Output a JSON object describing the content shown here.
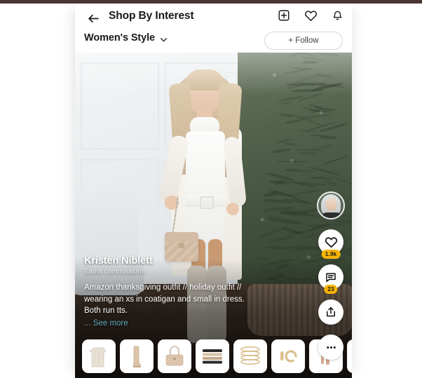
{
  "theme": {
    "top_border_color": "#4a3530",
    "badge_color": "#f5b400",
    "link_color": "#5aa9bd",
    "text_dark": "#17191a"
  },
  "header": {
    "back_icon": "back-arrow-icon",
    "title": "Shop By Interest",
    "icons": [
      {
        "name": "add-plus-square-icon",
        "label": "Add"
      },
      {
        "name": "heart-icon",
        "label": "Likes"
      },
      {
        "name": "bell-icon",
        "label": "Notifications"
      }
    ],
    "category": "Women's Style",
    "category_caret": "chevron-down-icon",
    "follow_label": "+ Follow"
  },
  "post": {
    "creator_name": "Kristen Niblett",
    "creator_subtitle": "Earns commissions",
    "caption": "Amazon thanksgiving outfit // holiday outfit // wearing an xs in coatigan and small in dress. Both run tts.",
    "see_more_dots": "... ",
    "see_more_label": "See more"
  },
  "rail": {
    "avatar_name": "creator-avatar",
    "actions": [
      {
        "name": "like-button",
        "icon": "heart-icon",
        "count": "1.9k"
      },
      {
        "name": "comment-button",
        "icon": "comment-bubble-icon",
        "count": "23"
      },
      {
        "name": "share-button",
        "icon": "share-upload-icon",
        "count": ""
      },
      {
        "name": "more-options-button",
        "icon": "ellipsis-icon",
        "count": ""
      }
    ]
  },
  "products": [
    {
      "name": "product-thumb-coatigan",
      "label": "Cream coatigan"
    },
    {
      "name": "product-thumb-boot",
      "label": "Tan knee boot"
    },
    {
      "name": "product-thumb-handbag",
      "label": "Quilted handbag"
    },
    {
      "name": "product-thumb-bracelets",
      "label": "Beaded bracelet stack"
    },
    {
      "name": "product-thumb-bangles",
      "label": "Gold bangle set"
    },
    {
      "name": "product-thumb-earrings",
      "label": "Gold hoop earrings"
    },
    {
      "name": "product-thumb-makeup",
      "label": "Makeup set"
    },
    {
      "name": "product-thumb-next",
      "label": "Next product"
    }
  ]
}
